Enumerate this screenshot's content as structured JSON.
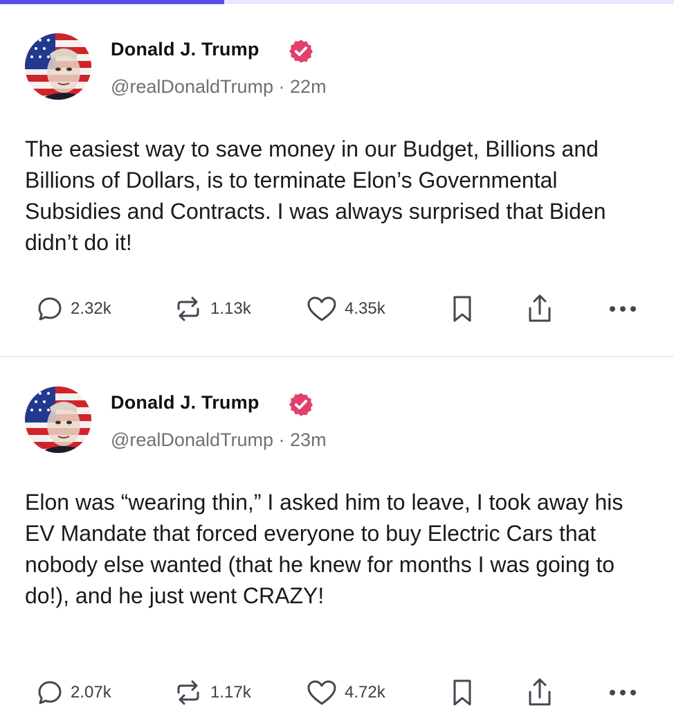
{
  "progress": {
    "fraction": 0.333,
    "color": "#5b4cf0"
  },
  "accent_color": "#e2406d",
  "posts": [
    {
      "author": "Donald J. Trump",
      "handle": "@realDonaldTrump",
      "time": "22m",
      "text": "The easiest way to save money in our Budget, Billions and Billions of Dollars, is to terminate Elon’s Governmental Subsidies and Contracts. I was always surprised that Biden didn’t do it!",
      "replies": "2.32k",
      "reposts": "1.13k",
      "likes": "4.35k"
    },
    {
      "author": "Donald J. Trump",
      "handle": "@realDonaldTrump",
      "time": "23m",
      "text": "Elon was “wearing thin,” I asked him to leave, I took away his EV Mandate that forced everyone to buy Electric Cars that nobody else wanted (that he knew for months I was going to do!), and he just went CRAZY!",
      "replies": "2.07k",
      "reposts": "1.17k",
      "likes": "4.72k"
    }
  ],
  "icons": {
    "reply": "speech-bubble-icon",
    "repost": "repost-arrows-icon",
    "like": "heart-icon",
    "save": "bookmark-icon",
    "share": "share-upload-icon",
    "more": "more-dots-icon",
    "verified": "verified-badge-icon"
  },
  "separator": "·"
}
